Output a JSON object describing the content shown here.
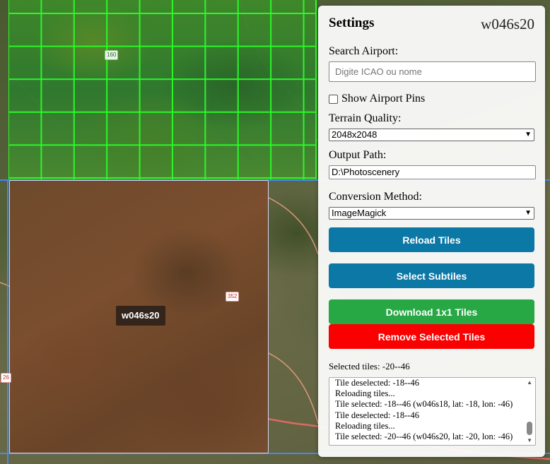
{
  "map": {
    "selected_tile_label": "w046s20",
    "road_badges": [
      "160",
      "352",
      "26"
    ]
  },
  "panel": {
    "title": "Settings",
    "current_tile": "w046s20",
    "search": {
      "label": "Search Airport:",
      "placeholder": "Digite ICAO ou nome",
      "value": ""
    },
    "show_pins": {
      "label": "Show Airport Pins",
      "checked": false
    },
    "terrain_quality": {
      "label": "Terrain Quality:",
      "value": "2048x2048"
    },
    "output_path": {
      "label": "Output Path:",
      "value": "D:\\Photoscenery"
    },
    "conversion_method": {
      "label": "Conversion Method:",
      "value": "ImageMagick"
    },
    "buttons": {
      "reload": "Reload Tiles",
      "subtiles": "Select Subtiles",
      "download": "Download 1x1 Tiles",
      "remove": "Remove Selected Tiles"
    },
    "selected_tiles": "Selected tiles: -20--46",
    "log": [
      "Tile deselected: -18--46",
      "Reloading tiles...",
      "Tile selected: -18--46 (w046s18, lat: -18, lon: -46)",
      "Tile deselected: -18--46",
      "Reloading tiles...",
      "Tile selected: -20--46 (w046s20, lat: -20, lon: -46)"
    ]
  },
  "colors": {
    "primary_button": "#0b78a6",
    "success_button": "#27a844",
    "danger_button": "#fa0000",
    "grid_green": "#2bff2b",
    "tile_border": "#d8d2f0"
  }
}
